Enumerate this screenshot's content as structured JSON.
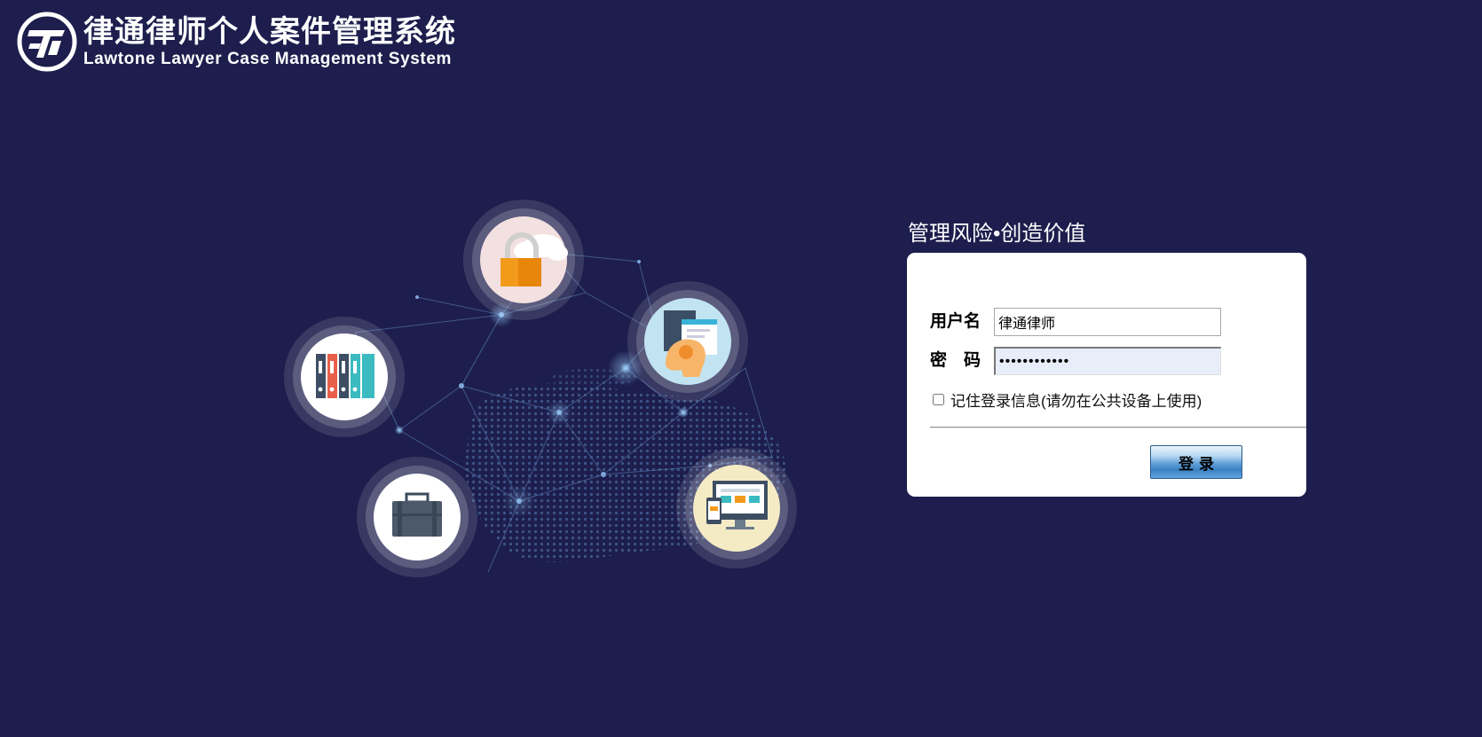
{
  "app": {
    "title_cn": "律通律师个人案件管理系统",
    "title_en": "Lawtone Lawyer Case Management System"
  },
  "slogan": "管理风险•创造价值",
  "login": {
    "username_label": "用户名",
    "username_value": "律通律师",
    "password_label": "密　码",
    "password_value": "••••••••••••",
    "remember_label": "记住登录信息(请勿在公共设备上使用)",
    "remember_checked": false,
    "submit_label": "登录"
  },
  "colors": {
    "background": "#1d1e4d",
    "panel": "#ffffff",
    "button": "#3c82c4"
  },
  "illustration": {
    "icons": [
      "lock-cloud-icon",
      "folders-icon",
      "mind-screen-icon",
      "briefcase-icon",
      "devices-icon"
    ]
  }
}
